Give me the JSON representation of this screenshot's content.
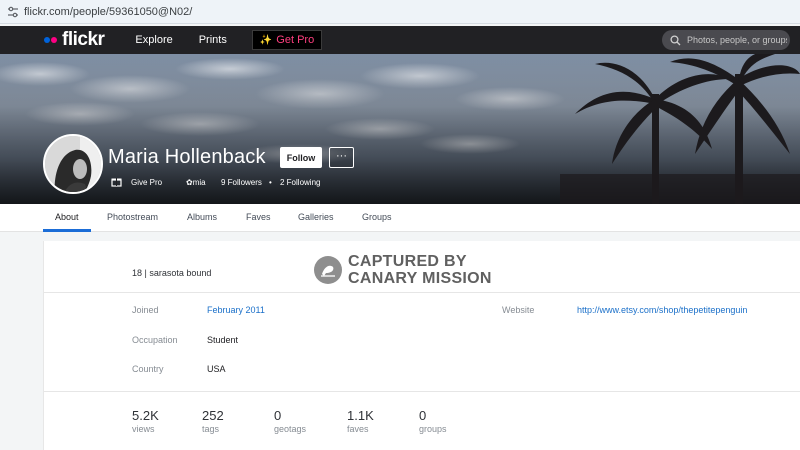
{
  "browser": {
    "url": "flickr.com/people/59361050@N02/"
  },
  "nav": {
    "logo": "flickr",
    "links": [
      "Explore",
      "Prints"
    ],
    "get_pro": "Get Pro",
    "search_placeholder": "Photos, people, or groups",
    "colors": {
      "blue": "#0063dc",
      "pink": "#ff0084"
    }
  },
  "profile": {
    "name": "Maria Hollenback",
    "follow_label": "Follow",
    "more_label": "···",
    "give_pro": "Give Pro",
    "username": "mia",
    "followers": "9 Followers",
    "separator": "•",
    "following": "2 Following"
  },
  "tabs": [
    "About",
    "Photostream",
    "Albums",
    "Faves",
    "Galleries",
    "Groups"
  ],
  "active_tab": "About",
  "about": {
    "bio": "18 | sarasota bound",
    "stamp_line1": "CAPTURED BY",
    "stamp_line2": "CANARY MISSION",
    "details": [
      {
        "label": "Joined",
        "value": "February 2011"
      },
      {
        "label": "Occupation",
        "value": "Student"
      },
      {
        "label": "Country",
        "value": "USA"
      }
    ],
    "website": {
      "label": "Website",
      "value": "http://www.etsy.com/shop/thepetitepenguin"
    }
  },
  "stats": [
    {
      "value": "5.2K",
      "label": "views"
    },
    {
      "value": "252",
      "label": "tags"
    },
    {
      "value": "0",
      "label": "geotags"
    },
    {
      "value": "1.1K",
      "label": "faves"
    },
    {
      "value": "0",
      "label": "groups"
    }
  ]
}
